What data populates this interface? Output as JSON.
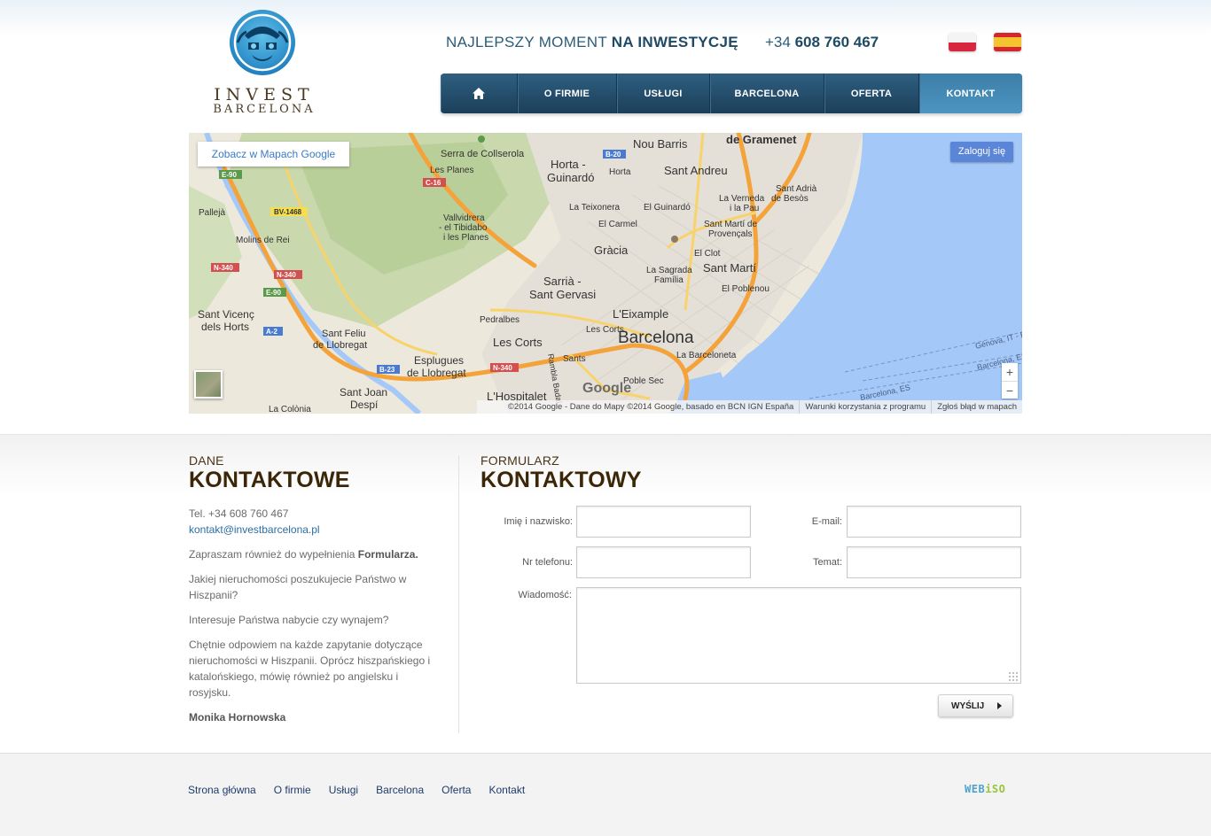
{
  "logo": {
    "line1": "INVEST",
    "line2": "BARCELONA"
  },
  "header": {
    "tagline_regular": "NAJLEPSZY MOMENT",
    "tagline_bold": "NA INWESTYCJĘ",
    "phone_prefix": "+34",
    "phone_number": "608 760 467"
  },
  "flags": [
    "polish-flag",
    "spanish-flag"
  ],
  "nav": {
    "home_icon": "home-icon",
    "items": [
      "O FIRMIE",
      "USŁUGI",
      "BARCELONA",
      "OFERTA",
      "KONTAKT"
    ],
    "active": "KONTAKT"
  },
  "map": {
    "open_link": "Zobacz w Mapach Google",
    "login": "Zaloguj się",
    "zoom_in": "+",
    "zoom_out": "−",
    "brand": "Google",
    "footer_copy": "©2014 Google - Dane do Mapy ©2014 Google, basado en BCN IGN España",
    "footer_terms": "Warunki korzystania z programu",
    "footer_report": "Zgłoś błąd w mapach",
    "labels": {
      "city": "Barcelona",
      "serra": "Serra de Collserola",
      "nou_barris": "Nou Barris",
      "gramenet": "de Gramenet",
      "horta": "Horta -\nGuinardó",
      "horta_small": "Horta",
      "sant_andreu": "Sant Andreu",
      "les_planes": "Les Planes",
      "vallvidrera": "Vallvidrera\n- el Tibidabo\ni les Planes",
      "la_teixonera": "La Teixonera",
      "el_guinardo": "El Guinardó",
      "la_verneda": "La Verneda\ni la Pau",
      "sant_adria": "Sant Adrià\nde Besòs",
      "el_carmel": "El Carmel",
      "sant_marti_prov": "Sant Martí de\nProvençals",
      "palleja": "Pallejà",
      "molins": "Molins de Rei",
      "gracia": "Gràcia",
      "el_clot": "El Clot",
      "sagrada": "La Sagrada\nFamília",
      "sant_marti": "Sant Martí",
      "sarria": "Sarrià -\nSant Gervasi",
      "el_poblenou": "El Poblenou",
      "sant_vicenc": "Sant Vicenç\ndels Horts",
      "pedralbes": "Pedralbes",
      "eixample": "L'Eixample",
      "sant_feliu": "Sant Feliu\nde Llobregat",
      "les_corts": "Les Corts",
      "les_corts_small": "Les Corts",
      "barceloneta": "La Barceloneta",
      "esplugues": "Esplugues\nde Llobregat",
      "sants": "Sants",
      "rambla": "Rambla Badal",
      "sant_joan": "Sant Joan\nDespí",
      "hospitalet": "L'Hospitalet",
      "poble_sec": "Poble Sec",
      "la_colonia": "La Colònia",
      "genova": "Génova, IT - B",
      "barcelona_es": "Barcelona, ES",
      "e90_a": "E-90",
      "c16": "C-16",
      "b20": "B-20",
      "bv1468": "BV-1468",
      "n340_a": "N-340",
      "n340_b": "N-340",
      "e90_b": "E-90",
      "a2": "A-2",
      "b23": "B-23",
      "n340_c": "N-340"
    }
  },
  "contact_info": {
    "heading_small": "DANE",
    "heading_big": "KONTAKTOWE",
    "tel": "Tel. +34 608 760 467",
    "email": "kontakt@investbarcelona.pl",
    "p1_prefix": "Zapraszam również do wypełnienia ",
    "p1_bold": "Formularza.",
    "p2": "Jakiej nieruchomości poszukujecie Państwo w Hiszpanii?",
    "p3": "Interesuje Państwa nabycie czy wynajem?",
    "p4": "Chętnie odpowiem na każde zapytanie dotyczące nieruchomości w Hiszpanii. Oprócz hiszpańskiego i katalońskiego, mówię również po angielsku i rosyjsku.",
    "signature": "Monika Hornowska"
  },
  "form": {
    "heading_small": "FORMULARZ",
    "heading_big": "KONTAKTOWY",
    "name_label": "Imię i nazwisko:",
    "name_value": "",
    "email_label": "E-mail:",
    "email_value": "",
    "phone_label": "Nr telefonu:",
    "phone_value": "",
    "subject_label": "Temat:",
    "subject_value": "",
    "message_label": "Wiadomość:",
    "message_value": "",
    "submit": "WYŚLIJ"
  },
  "footer": {
    "links": [
      "Strona główna",
      "O firmie",
      "Usługi",
      "Barcelona",
      "Oferta",
      "Kontakt"
    ],
    "brand_part1": "WEB",
    "brand_part2": "iSO"
  },
  "colors": {
    "nav_dark": "#1b3f5a",
    "nav_active": "#4c95c2",
    "heading_brown": "#3b2708",
    "link_blue": "#2a6fa3",
    "sea": "#a4c8f8"
  }
}
